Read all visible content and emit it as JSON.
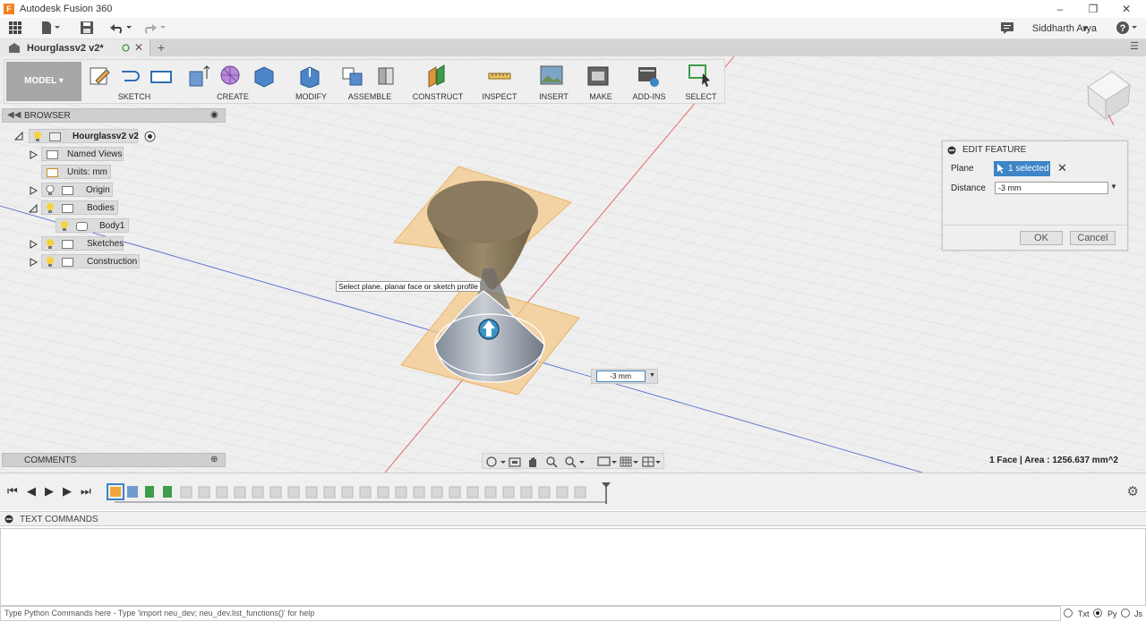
{
  "window": {
    "title": "Autodesk Fusion 360",
    "app_icon": "F"
  },
  "user": {
    "name": "Siddharth Arya"
  },
  "document": {
    "tab_name": "Hourglassv2 v2*"
  },
  "toolbar": {
    "workspace": "MODEL",
    "groups": [
      "SKETCH",
      "CREATE",
      "MODIFY",
      "ASSEMBLE",
      "CONSTRUCT",
      "INSPECT",
      "INSERT",
      "MAKE",
      "ADD-INS",
      "SELECT"
    ]
  },
  "browser": {
    "title": "BROWSER",
    "root": "Hourglassv2 v2",
    "items": {
      "named_views": "Named Views",
      "units": "Units: mm",
      "origin": "Origin",
      "bodies": "Bodies",
      "body1": "Body1",
      "sketches": "Sketches",
      "construction": "Construction"
    }
  },
  "dialog": {
    "title": "EDIT FEATURE",
    "plane_label": "Plane",
    "plane_value": "1 selected",
    "distance_label": "Distance",
    "distance_value": "-3 mm",
    "ok": "OK",
    "cancel": "Cancel"
  },
  "viewport": {
    "tooltip": "Select plane, planar face or sketch profile",
    "distance_input": "-3 mm",
    "status": "1 Face | Area : 1256.637 mm^2"
  },
  "comments": {
    "title": "COMMENTS"
  },
  "text_commands": {
    "title": "TEXT COMMANDS",
    "placeholder": "Type Python Commands here - Type 'import neu_dev; neu_dev.list_functions()' for help",
    "options": [
      "Txt",
      "Py",
      "Js"
    ],
    "selected": "Py"
  },
  "colors": {
    "accent": "#3d85c6",
    "plane": "#f4c98a",
    "body": "#8b7a5f"
  }
}
